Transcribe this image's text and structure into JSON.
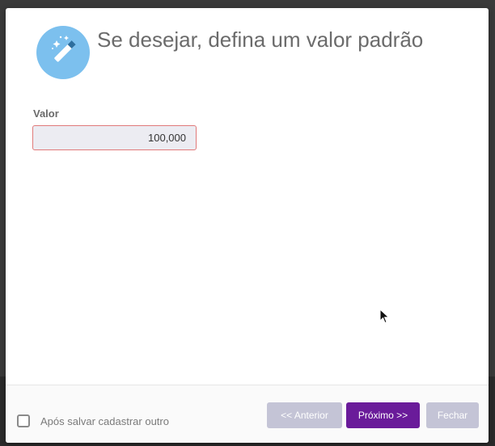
{
  "dialog": {
    "title": "Se desejar, defina um valor padrão",
    "header_icon": "magic-wand-icon",
    "accent_color": "#7cc0ee"
  },
  "form": {
    "value_label": "Valor",
    "value": "100,000"
  },
  "footer": {
    "checkbox_label": "Após salvar cadastrar outro",
    "checkbox_checked": false,
    "prev_label": "<< Anterior",
    "next_label": "Próximo >>",
    "close_label": "Fechar",
    "primary_color": "#6a1b9a",
    "disabled_color": "#c4c4d6"
  }
}
